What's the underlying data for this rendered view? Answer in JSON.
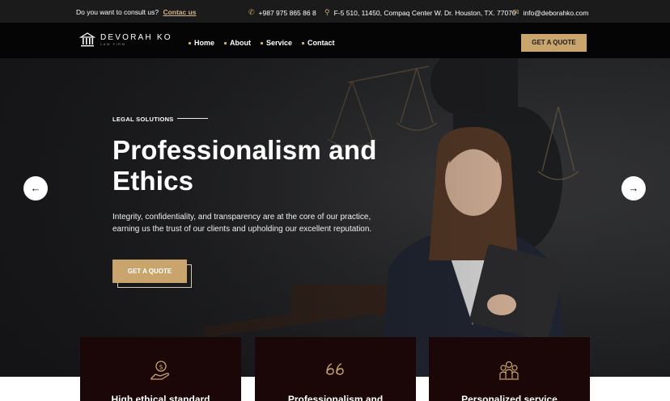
{
  "topbar": {
    "consult_text": "Do you want to consult us?",
    "consult_link": "Contac us",
    "phone": "+987 975 865 86 8",
    "address": "F-5 510, 11450, Compaq Center W. Dr. Houston, TX. 77070",
    "email": "info@deborahko.com"
  },
  "logo": {
    "name": "DEVORAH KO",
    "sub": "LAW FIRM"
  },
  "nav": {
    "items": [
      "Home",
      "About",
      "Service",
      "Contact"
    ]
  },
  "header_cta": "GET A QUOTE",
  "hero": {
    "eyebrow": "LEGAL SOLUTIONS",
    "headline": "Professionalism and Ethics",
    "lead": "Integrity, confidentiality, and transparency are at the core of our practice, earning us the trust of our clients and upholding our excellent reputation.",
    "cta": "GET A QUOTE"
  },
  "icons": {
    "phone": "phone-icon",
    "location": "location-pin-icon",
    "email": "envelope-icon",
    "prev": "arrow-left-icon",
    "next": "arrow-right-icon"
  },
  "colors": {
    "accent": "#c9a46c",
    "dark": "#050505",
    "card": "#1c0708"
  },
  "cards": [
    {
      "title": "High ethical standard",
      "icon": "hand-coin-icon"
    },
    {
      "title": "Professionalism and",
      "icon": "quote-icon"
    },
    {
      "title": "Personalized service",
      "icon": "team-icon"
    }
  ]
}
